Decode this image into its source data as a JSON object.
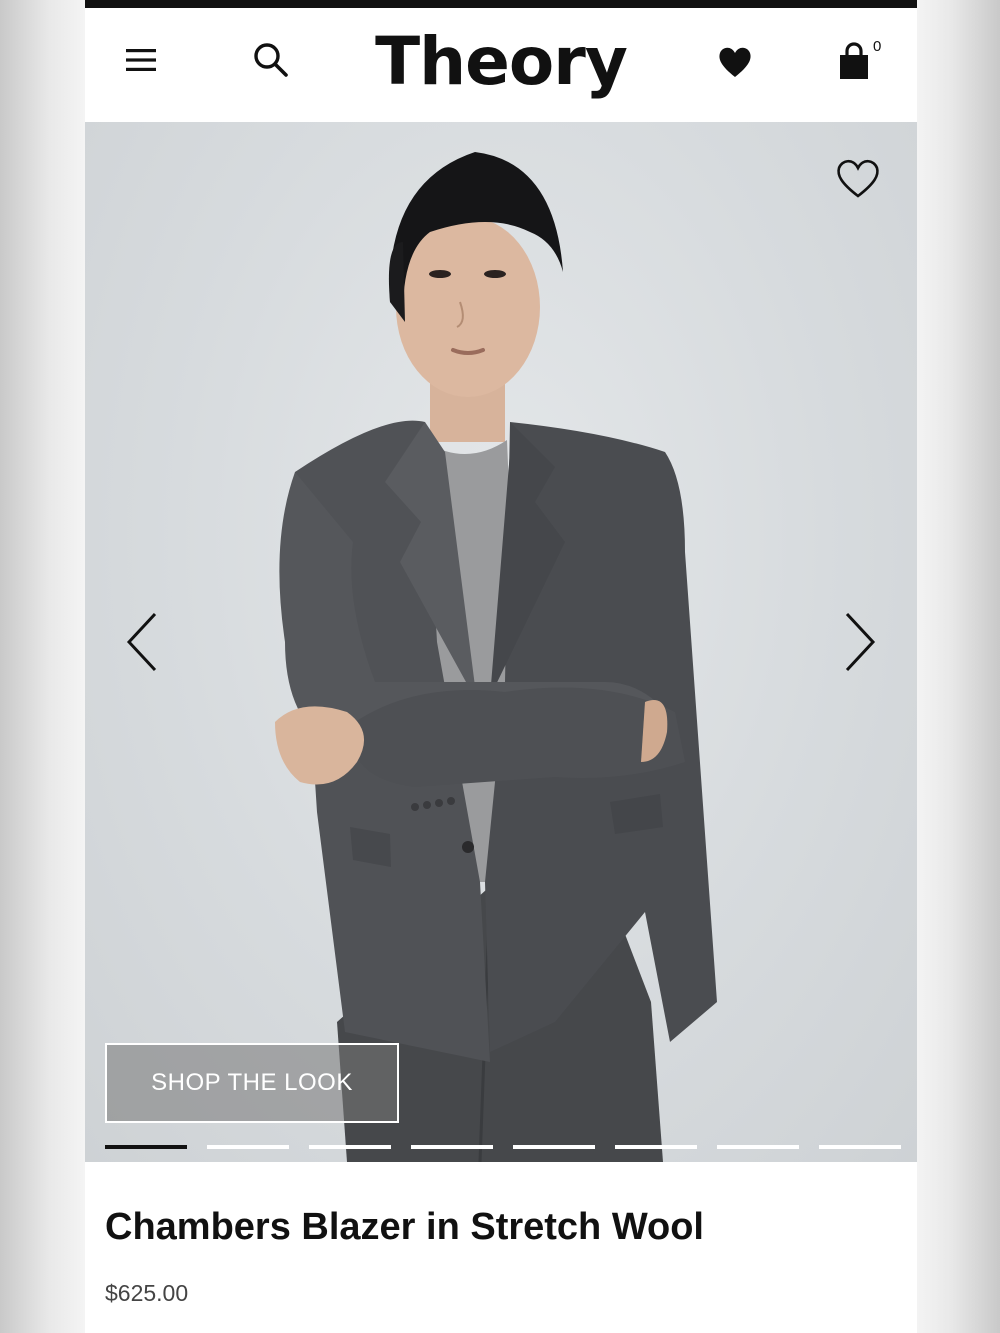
{
  "header": {
    "logo": "Theory",
    "menu_icon": "hamburger-menu-icon",
    "search_icon": "search-icon",
    "wishlist_icon": "heart-filled-icon",
    "bag_icon": "shopping-bag-icon",
    "bag_count": "0"
  },
  "gallery": {
    "favorite_icon": "heart-outline-icon",
    "prev_icon": "chevron-left-icon",
    "next_icon": "chevron-right-icon",
    "shop_the_look": "SHOP THE LOOK",
    "slides_total": 8,
    "active_slide": 1
  },
  "product": {
    "name": "Chambers Blazer in Stretch Wool",
    "price": "$625.00"
  },
  "colors": {
    "text": "#111111",
    "price": "#444444",
    "blazer": "#4b4d50"
  }
}
